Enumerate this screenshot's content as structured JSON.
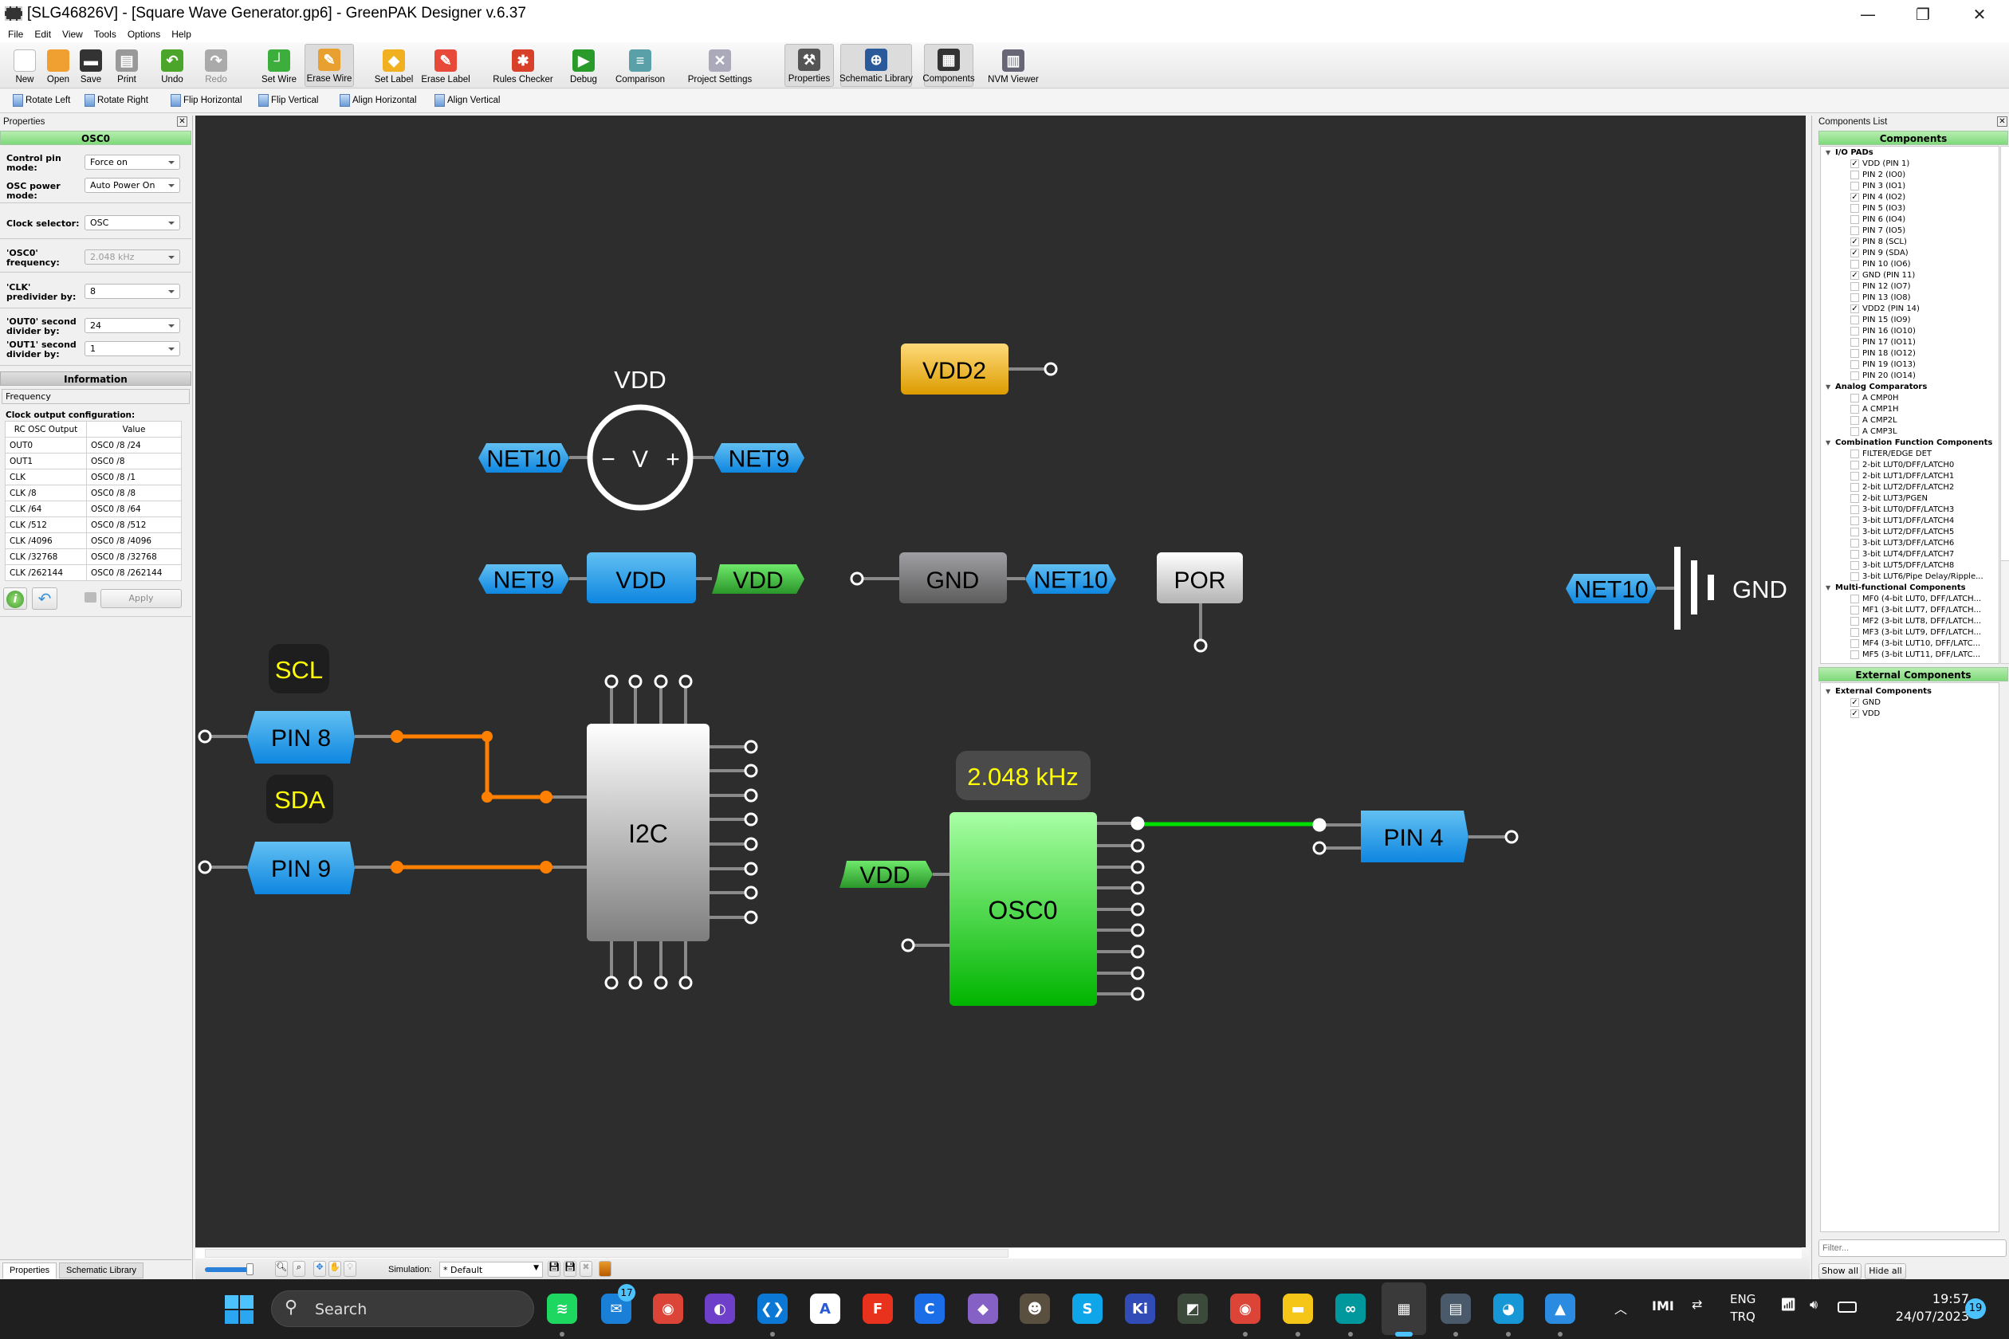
{
  "window": {
    "title": "[SLG46826V] - [Square Wave Generator.gp6] - GreenPAK Designer v.6.37",
    "controls": [
      "minimize",
      "restore",
      "close"
    ]
  },
  "menu": [
    "File",
    "Edit",
    "View",
    "Tools",
    "Options",
    "Help"
  ],
  "toolbar": [
    {
      "label": "New",
      "icon": "new-file-icon"
    },
    {
      "label": "Open",
      "icon": "folder-open-icon"
    },
    {
      "label": "Save",
      "icon": "floppy-disk-icon"
    },
    {
      "label": "Print",
      "icon": "printer-icon"
    },
    {
      "label": "Undo",
      "icon": "undo-icon"
    },
    {
      "label": "Redo",
      "icon": "redo-icon",
      "disabled": true
    },
    {
      "label": "Set Wire",
      "icon": "set-wire-icon"
    },
    {
      "label": "Erase Wire",
      "icon": "erase-wire-icon",
      "pressed": true
    },
    {
      "label": "Set Label",
      "icon": "label-tag-icon"
    },
    {
      "label": "Erase Label",
      "icon": "erase-label-icon"
    },
    {
      "label": "Rules Checker",
      "icon": "ladybug-icon"
    },
    {
      "label": "Debug",
      "icon": "debug-icon"
    },
    {
      "label": "Comparison",
      "icon": "comparison-icon"
    },
    {
      "label": "Project Settings",
      "icon": "wrench-screwdriver-icon"
    },
    {
      "label": "Properties",
      "icon": "hammer-icon",
      "pressed": true
    },
    {
      "label": "Schematic Library",
      "icon": "library-book-icon",
      "pressed": true
    },
    {
      "label": "Components",
      "icon": "chip-icon",
      "pressed": true
    },
    {
      "label": "NVM Viewer",
      "icon": "nvm-grid-icon"
    }
  ],
  "toolbar2": [
    "Rotate Left",
    "Rotate Right",
    "Flip Horizontal",
    "Flip Vertical",
    "Align Horizontal",
    "Align Vertical"
  ],
  "properties": {
    "panel_title": "Properties",
    "block_title": "OSC0",
    "fields": [
      {
        "label": "Control pin mode:",
        "value": "Force on"
      },
      {
        "label": "OSC power mode:",
        "value": "Auto Power On"
      },
      {
        "label": "Clock selector:",
        "value": "OSC"
      },
      {
        "label": "'OSC0' frequency:",
        "value": "2.048 kHz",
        "disabled": true
      },
      {
        "label": "'CLK' predivider by:",
        "value": "8"
      },
      {
        "label": "'OUT0' second divider by:",
        "value": "24"
      },
      {
        "label": "'OUT1' second divider by:",
        "value": "1"
      }
    ],
    "information_title": "Information",
    "frequency_label": "Frequency",
    "clock_config_title": "Clock output configuration:",
    "table": {
      "headers": [
        "RC OSC Output",
        "Value"
      ],
      "rows": [
        [
          "OUT0",
          "OSC0 /8 /24"
        ],
        [
          "OUT1",
          "OSC0 /8"
        ],
        [
          "CLK",
          "OSC0 /8 /1"
        ],
        [
          "CLK /8",
          "OSC0 /8 /8"
        ],
        [
          "CLK /64",
          "OSC0 /8 /64"
        ],
        [
          "CLK /512",
          "OSC0 /8 /512"
        ],
        [
          "CLK /4096",
          "OSC0 /8 /4096"
        ],
        [
          "CLK /32768",
          "OSC0 /8 /32768"
        ],
        [
          "CLK /262144",
          "OSC0 /8 /262144"
        ]
      ]
    },
    "apply_label": "Apply",
    "tabs": [
      "Properties",
      "Schematic Library"
    ]
  },
  "components_list": {
    "panel_title": "Components List",
    "header": "Components",
    "groups": [
      {
        "name": "I/O PADs",
        "items": [
          {
            "label": "VDD (PIN 1)",
            "checked": true
          },
          {
            "label": "PIN 2 (IO0)",
            "checked": false
          },
          {
            "label": "PIN 3 (IO1)",
            "checked": false
          },
          {
            "label": "PIN 4 (IO2)",
            "checked": true
          },
          {
            "label": "PIN 5 (IO3)",
            "checked": false
          },
          {
            "label": "PIN 6 (IO4)",
            "checked": false
          },
          {
            "label": "PIN 7 (IO5)",
            "checked": false
          },
          {
            "label": "PIN 8 (SCL)",
            "checked": true
          },
          {
            "label": "PIN 9 (SDA)",
            "checked": true
          },
          {
            "label": "PIN 10 (IO6)",
            "checked": false
          },
          {
            "label": "GND (PIN 11)",
            "checked": true
          },
          {
            "label": "PIN 12 (IO7)",
            "checked": false
          },
          {
            "label": "PIN 13 (IO8)",
            "checked": false
          },
          {
            "label": "VDD2 (PIN 14)",
            "checked": true
          },
          {
            "label": "PIN 15 (IO9)",
            "checked": false
          },
          {
            "label": "PIN 16 (IO10)",
            "checked": false
          },
          {
            "label": "PIN 17 (IO11)",
            "checked": false
          },
          {
            "label": "PIN 18 (IO12)",
            "checked": false
          },
          {
            "label": "PIN 19 (IO13)",
            "checked": false
          },
          {
            "label": "PIN 20 (IO14)",
            "checked": false
          }
        ]
      },
      {
        "name": "Analog Comparators",
        "items": [
          {
            "label": "A CMP0H",
            "checked": false
          },
          {
            "label": "A CMP1H",
            "checked": false
          },
          {
            "label": "A CMP2L",
            "checked": false
          },
          {
            "label": "A CMP3L",
            "checked": false
          }
        ]
      },
      {
        "name": "Combination Function Components",
        "items": [
          {
            "label": "FILTER/EDGE DET",
            "checked": false
          },
          {
            "label": "2-bit LUT0/DFF/LATCH0",
            "checked": false
          },
          {
            "label": "2-bit LUT1/DFF/LATCH1",
            "checked": false
          },
          {
            "label": "2-bit LUT2/DFF/LATCH2",
            "checked": false
          },
          {
            "label": "2-bit LUT3/PGEN",
            "checked": false
          },
          {
            "label": "3-bit LUT0/DFF/LATCH3",
            "checked": false
          },
          {
            "label": "3-bit LUT1/DFF/LATCH4",
            "checked": false
          },
          {
            "label": "3-bit LUT2/DFF/LATCH5",
            "checked": false
          },
          {
            "label": "3-bit LUT3/DFF/LATCH6",
            "checked": false
          },
          {
            "label": "3-bit LUT4/DFF/LATCH7",
            "checked": false
          },
          {
            "label": "3-bit LUT5/DFF/LATCH8",
            "checked": false
          },
          {
            "label": "3-bit LUT6/Pipe Delay/Ripple...",
            "checked": false
          }
        ]
      },
      {
        "name": "Multi-functional Components",
        "items": [
          {
            "label": "MF0 (4-bit LUT0, DFF/LATCH...",
            "checked": false
          },
          {
            "label": "MF1 (3-bit LUT7, DFF/LATCH...",
            "checked": false
          },
          {
            "label": "MF2 (3-bit LUT8, DFF/LATCH...",
            "checked": false
          },
          {
            "label": "MF3 (3-bit LUT9, DFF/LATCH...",
            "checked": false
          },
          {
            "label": "MF4 (3-bit LUT10, DFF/LATC...",
            "checked": false
          },
          {
            "label": "MF5 (3-bit LUT11, DFF/LATC...",
            "checked": false
          }
        ]
      }
    ],
    "external_header": "External Components",
    "external_group": {
      "name": "External Components",
      "items": [
        {
          "label": "GND",
          "checked": true
        },
        {
          "label": "VDD",
          "checked": true
        }
      ]
    },
    "filter_placeholder": "Filter...",
    "show_all": "Show all",
    "hide_all": "Hide all"
  },
  "canvas": {
    "vsource": {
      "title": "VDD",
      "minus": "−",
      "symbol": "V",
      "plus": "+"
    },
    "net10_a": "NET10",
    "net9_a": "NET9",
    "vdd2": "VDD2",
    "net9_b": "NET9",
    "vdd_block": "VDD",
    "vdd_tag": "VDD",
    "gnd_block": "GND",
    "net10_b": "NET10",
    "por": "POR",
    "net10_c": "NET10",
    "gnd_symbol": "GND",
    "scl": "SCL",
    "sda": "SDA",
    "pin8": "PIN 8",
    "pin9": "PIN 9",
    "i2c": "I2C",
    "frequency": "2.048 kHz",
    "osc_vdd": "VDD",
    "osc0": "OSC0",
    "pin4": "PIN 4",
    "colors": {
      "background": "#2d2d2d",
      "i2c_wire": "#ff8000",
      "osc_wire": "#00e000",
      "frequency_text": "#ffff00"
    }
  },
  "bottom_bar": {
    "simulation_label": "Simulation:",
    "simulation_value": "* Default"
  },
  "taskbar": {
    "search_placeholder": "Search",
    "apps": [
      {
        "name": "spotify",
        "glyph": "≋",
        "color": "#1ed760",
        "running": true
      },
      {
        "name": "mail",
        "glyph": "✉",
        "color": "#1a7fd6",
        "badge": "17"
      },
      {
        "name": "chrome",
        "glyph": "◉",
        "color": "#db4437"
      },
      {
        "name": "github-desktop",
        "glyph": "◐",
        "color": "#6e40c9"
      },
      {
        "name": "vscode",
        "glyph": "❮❯",
        "color": "#0a78d4",
        "running": true
      },
      {
        "name": "android-studio",
        "glyph": "A",
        "color": "#ffffff"
      },
      {
        "name": "fusion",
        "glyph": "F",
        "color": "#e8321e"
      },
      {
        "name": "c-app",
        "glyph": "C",
        "color": "#1b6ee8"
      },
      {
        "name": "visual-studio",
        "glyph": "◆",
        "color": "#8661c5"
      },
      {
        "name": "gimp",
        "glyph": "☻",
        "color": "#5a5040"
      },
      {
        "name": "skype",
        "glyph": "S",
        "color": "#0ea5e9"
      },
      {
        "name": "kicad",
        "glyph": "Ki",
        "color": "#314cb6"
      },
      {
        "name": "image-viewer",
        "glyph": "◩",
        "color": "#3c4a3c"
      },
      {
        "name": "chrome",
        "glyph": "◉",
        "color": "#db4437",
        "running": true
      },
      {
        "name": "file-explorer",
        "glyph": "▬",
        "color": "#f5c518",
        "running": true
      },
      {
        "name": "arduino",
        "glyph": "∞",
        "color": "#00979d",
        "running": true
      },
      {
        "name": "greenpak",
        "glyph": "▦",
        "color": "#3a3a3a",
        "active": true
      },
      {
        "name": "calculator",
        "glyph": "▤",
        "color": "#4a5a6a",
        "running": true
      },
      {
        "name": "edge",
        "glyph": "◕",
        "color": "#1797d6",
        "running": true
      },
      {
        "name": "photos",
        "glyph": "▲",
        "color": "#2a8be0",
        "running": true
      }
    ],
    "tray": {
      "language_top": "ENG",
      "language_bottom": "TRQ",
      "time": "19:57",
      "date": "24/07/2023",
      "notifications": "19"
    }
  }
}
